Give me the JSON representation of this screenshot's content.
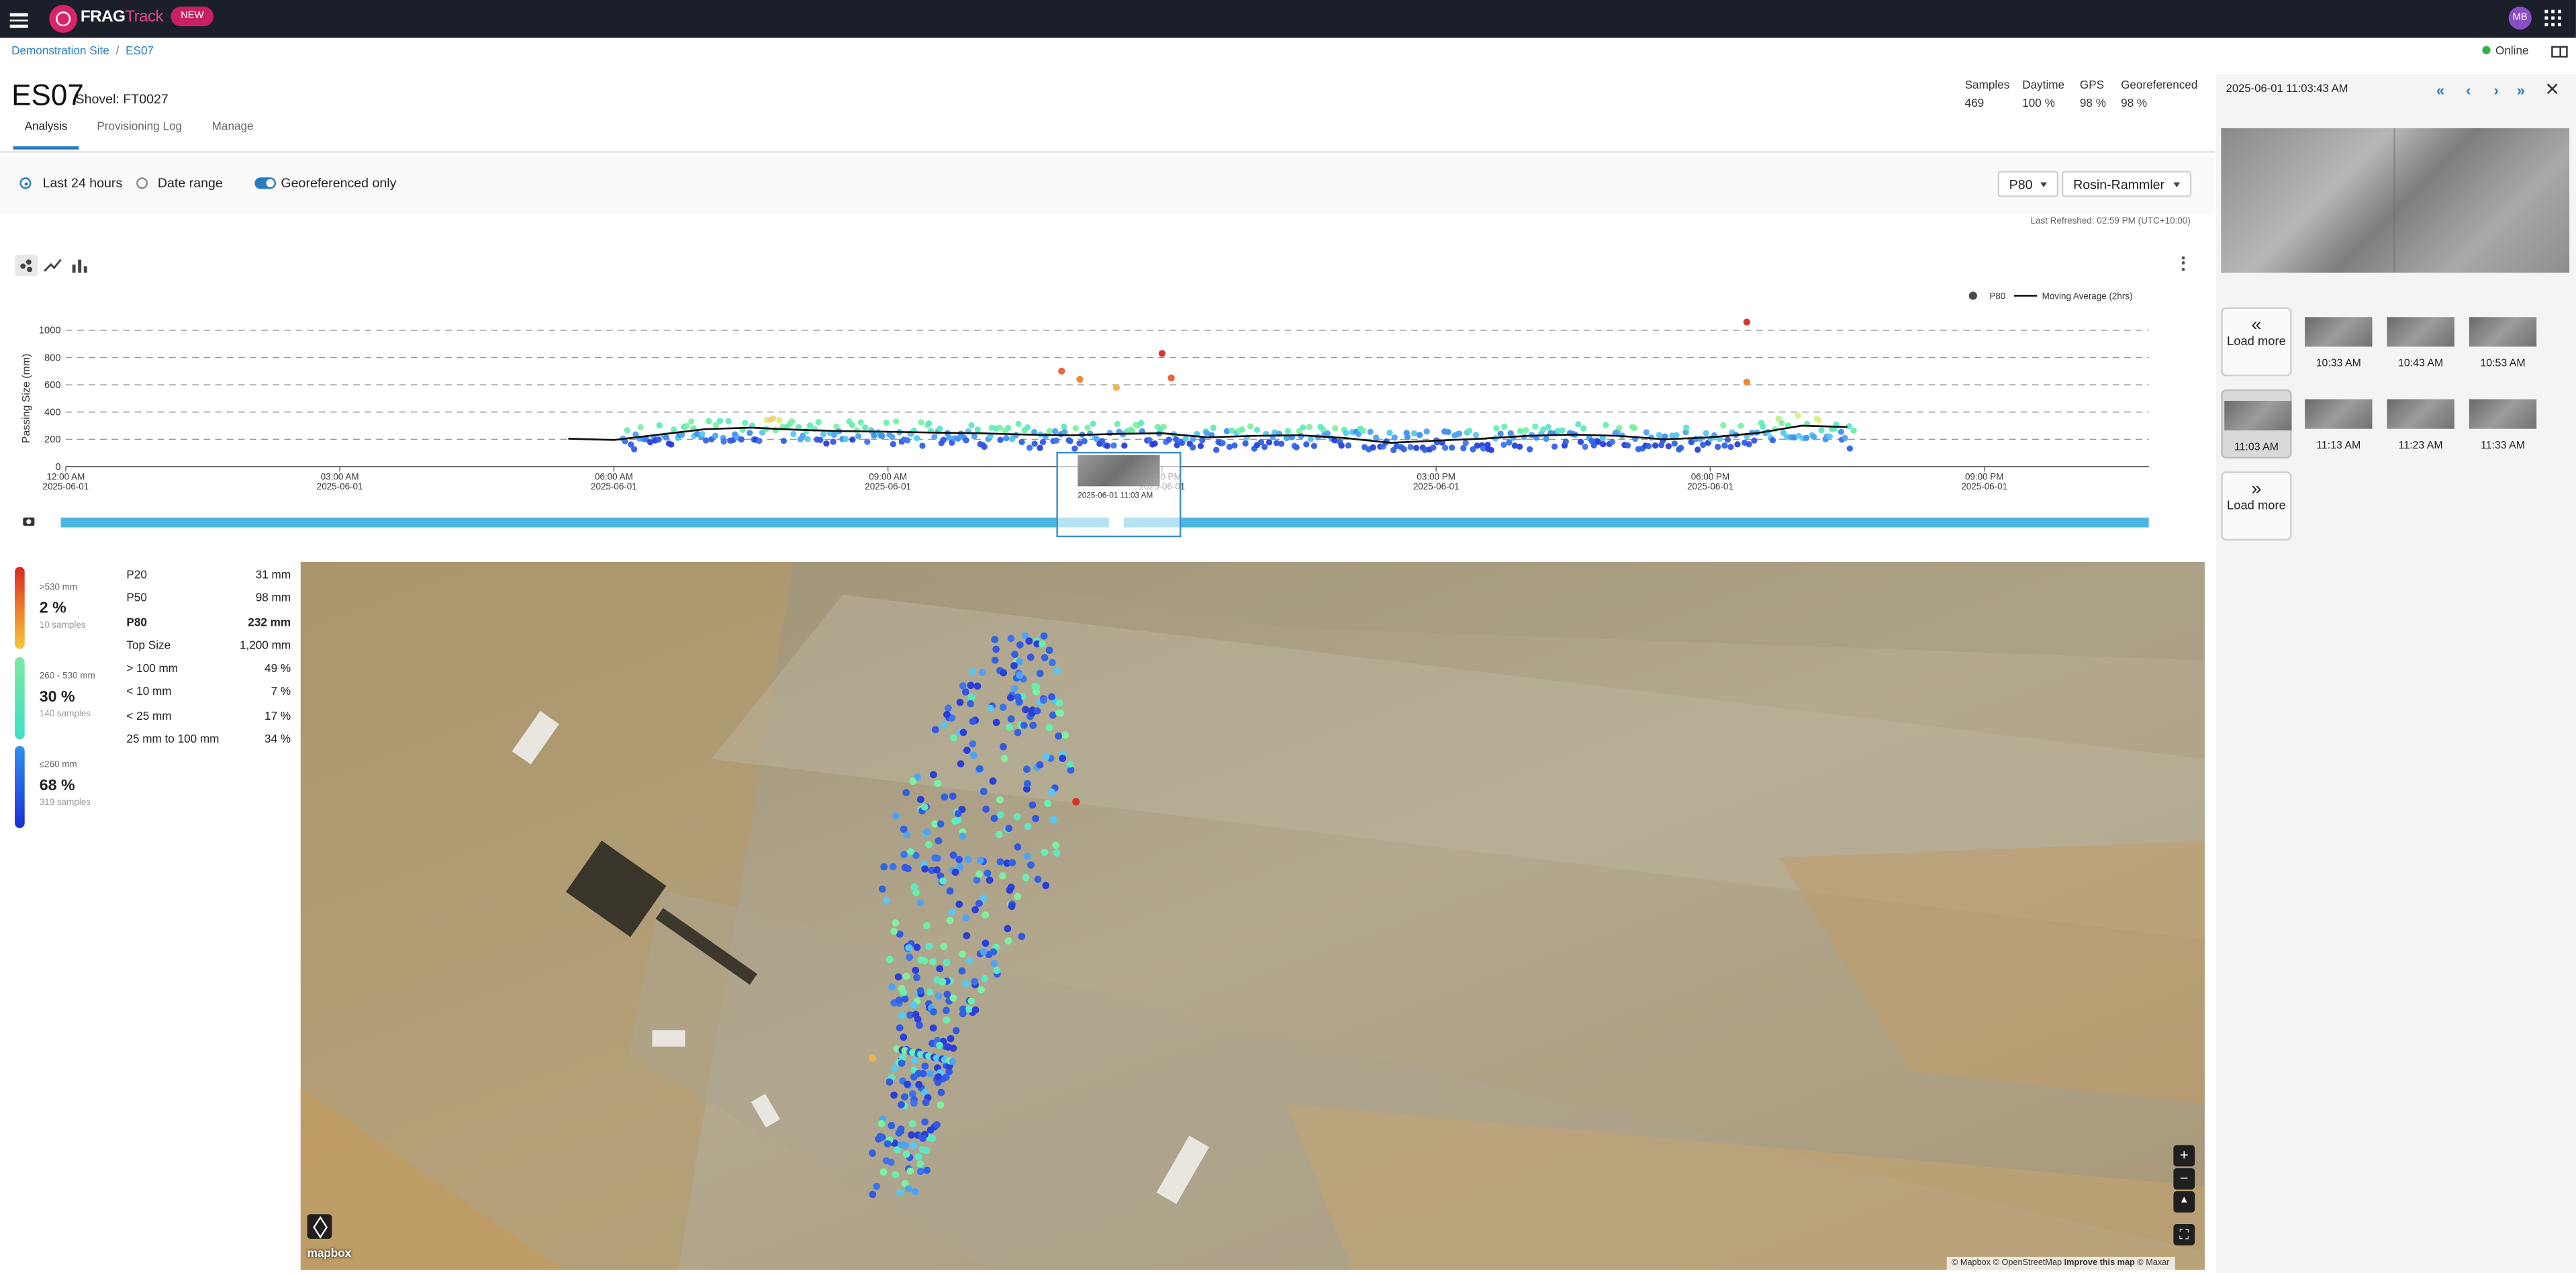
{
  "app": {
    "brand": "FRAG",
    "brand_suffix": "Track",
    "badge": "NEW",
    "user_initials": "MB",
    "status": "Online"
  },
  "breadcrumb": [
    "Demonstration Site",
    "ES07"
  ],
  "page": {
    "title": "ES07",
    "subtitle": "Shovel: FT0027"
  },
  "summary_stats": [
    {
      "label": "Samples",
      "value": "469"
    },
    {
      "label": "Daytime",
      "value": "100 %"
    },
    {
      "label": "GPS",
      "value": "98 %"
    },
    {
      "label": "Georeferenced",
      "value": "98 %"
    }
  ],
  "tabs": [
    {
      "label": "Analysis",
      "active": true
    },
    {
      "label": "Provisioning Log",
      "active": false
    },
    {
      "label": "Manage",
      "active": false
    }
  ],
  "filters": {
    "last_24h": "Last 24 hours",
    "date_range": "Date range",
    "georef_only": "Georeferenced only",
    "metric_select": "P80",
    "model_select": "Rosin-Rammler",
    "last_refreshed": "Last Refreshed: 02:59 PM (UTC+10:00)"
  },
  "chart_data": {
    "type": "scatter",
    "title": "",
    "xlabel": "",
    "ylabel": "Passing Size (mm)",
    "ylim": [
      0,
      1000
    ],
    "yticks": [
      "0",
      "200",
      "400",
      "600",
      "800",
      "1000"
    ],
    "xticks": [
      {
        "time": "12:00 AM",
        "date": "2025-06-01"
      },
      {
        "time": "03:00 AM",
        "date": "2025-06-01"
      },
      {
        "time": "06:00 AM",
        "date": "2025-06-01"
      },
      {
        "time": "09:00 AM",
        "date": "2025-06-01"
      },
      {
        "time": "12:00 PM",
        "date": "2025-06-01"
      },
      {
        "time": "03:00 PM",
        "date": "2025-06-01"
      },
      {
        "time": "06:00 PM",
        "date": "2025-06-01"
      },
      {
        "time": "09:00 PM",
        "date": "2025-06-01"
      }
    ],
    "xrange_hours": [
      0,
      22.8
    ],
    "grid": true,
    "legend_position": "top-right",
    "series": [
      {
        "name": "P80",
        "kind": "scatter",
        "color": "#4a4a4a"
      },
      {
        "name": "Moving Average (2hrs)",
        "kind": "line",
        "color": "#111111",
        "x_hours": [
          5.5,
          6.0,
          6.5,
          7.0,
          7.5,
          8.0,
          8.5,
          9.0,
          9.5,
          10.0,
          10.5,
          11.0,
          11.5,
          12.0,
          12.5,
          13.0,
          13.5,
          14.0,
          14.5,
          15.0,
          15.5,
          16.0,
          16.5,
          17.0,
          17.5,
          18.0,
          18.5,
          19.0,
          19.5
        ],
        "y": [
          205,
          195,
          235,
          275,
          285,
          270,
          260,
          255,
          250,
          245,
          235,
          230,
          240,
          245,
          215,
          225,
          230,
          210,
          175,
          190,
          205,
          225,
          235,
          225,
          200,
          215,
          245,
          300,
          290
        ]
      }
    ],
    "outliers": [
      {
        "x_hours": 10.9,
        "y": 700,
        "color": "#e8663a"
      },
      {
        "x_hours": 11.1,
        "y": 640,
        "color": "#f08a3a"
      },
      {
        "x_hours": 11.5,
        "y": 580,
        "color": "#f2b24a"
      },
      {
        "x_hours": 12.0,
        "y": 830,
        "color": "#d9342b"
      },
      {
        "x_hours": 12.1,
        "y": 650,
        "color": "#e8663a"
      },
      {
        "x_hours": 18.4,
        "y": 1060,
        "color": "#d9342b"
      },
      {
        "x_hours": 18.4,
        "y": 620,
        "color": "#f08a3a"
      }
    ],
    "sample_x_range_hours": [
      6.1,
      19.6
    ],
    "color_scale": [
      {
        "range": "≤260",
        "color": "#2b47e0"
      },
      {
        "range": "260 - 530",
        "color": "#5cf0b0"
      },
      {
        "range": ">530",
        "color": "#e8663a"
      }
    ],
    "selected_sample": {
      "label": "2025-06-01 11:03 AM",
      "x_hours": 11.05
    }
  },
  "distribution": {
    "buckets": [
      {
        "range": ">530 mm",
        "percent": "2 %",
        "count": "10 samples"
      },
      {
        "range": "260 - 530 mm",
        "percent": "30 %",
        "count": "140 samples"
      },
      {
        "range": "≤260 mm",
        "percent": "68 %",
        "count": "319 samples"
      }
    ],
    "stats": [
      {
        "label": "P20",
        "value": "31 mm",
        "bold": false
      },
      {
        "label": "P50",
        "value": "98 mm",
        "bold": false
      },
      {
        "label": "P80",
        "value": "232 mm",
        "bold": true
      },
      {
        "label": "Top Size",
        "value": "1,200 mm",
        "bold": false
      },
      {
        "label": "> 100 mm",
        "value": "49 %",
        "bold": false
      },
      {
        "label": "< 10 mm",
        "value": "7 %",
        "bold": false
      },
      {
        "label": "< 25 mm",
        "value": "17 %",
        "bold": false
      },
      {
        "label": "25 mm to 100 mm",
        "value": "34 %",
        "bold": false
      }
    ]
  },
  "map": {
    "logo": "mapbox",
    "attribution_prefix": "© Mapbox © OpenStreetMap",
    "attribution_link": "Improve this map",
    "attribution_suffix": "© Maxar",
    "zoom_in": "+",
    "zoom_out": "−",
    "compass": "▲",
    "fullscreen": "⛶"
  },
  "side_panel": {
    "timestamp": "2025-06-01 11:03:43 AM",
    "load_more": "Load more",
    "first_icon": "«",
    "prev_icon": "‹",
    "next_icon": "›",
    "last_icon": "»",
    "close_icon": "✕",
    "thumbs_row1": [
      "10:33 AM",
      "10:43 AM",
      "10:53 AM"
    ],
    "thumbs_row2": [
      "11:03 AM",
      "11:13 AM",
      "11:23 AM",
      "11:33 AM"
    ],
    "selected_thumb": "11:03 AM"
  }
}
